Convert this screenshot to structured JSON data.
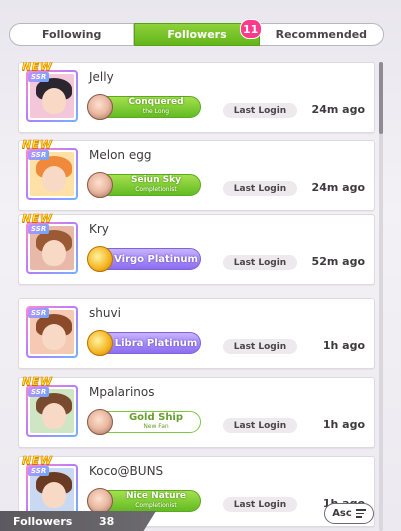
{
  "tabs": {
    "following": "Following",
    "followers": "Followers",
    "followers_badge": "11",
    "recommended": "Recommended"
  },
  "rows": [
    {
      "name": "Jelly",
      "new": "NEW",
      "rarity": "SSR",
      "title_line1": "Conquered",
      "title_line2": "the Long",
      "title_style": "green",
      "login_label": "Last Login",
      "time": "24m ago",
      "hair": "#2b2530",
      "bg": "#f4c6d9"
    },
    {
      "name": "Melon egg",
      "new": "NEW",
      "rarity": "SSR",
      "title_line1": "Seiun Sky",
      "title_line2": "Completionist",
      "title_style": "green",
      "login_label": "Last Login",
      "time": "24m ago",
      "hair": "#f08a3a",
      "bg": "#ffe1a8"
    },
    {
      "name": "Kry",
      "new": "NEW",
      "rarity": "SSR",
      "title_line1": "Virgo Platinum",
      "title_line2": "",
      "title_style": "purple",
      "login_label": "Last Login",
      "time": "52m ago",
      "hair": "#9a5a34",
      "bg": "#e8b9a8"
    },
    {
      "name": "shuvi",
      "new": "",
      "rarity": "SSR",
      "title_line1": "Libra Platinum",
      "title_line2": "",
      "title_style": "purple",
      "login_label": "Last Login",
      "time": "1h ago",
      "hair": "#8b4a2a",
      "bg": "#f5c9b4"
    },
    {
      "name": "Mpalarinos",
      "new": "NEW",
      "rarity": "SSR",
      "title_line1": "Gold Ship",
      "title_line2": "New Fan",
      "title_style": "white",
      "login_label": "Last Login",
      "time": "1h ago",
      "hair": "#7a4a2e",
      "bg": "#cfe6c4"
    },
    {
      "name": "Koco@BUNS",
      "new": "NEW",
      "rarity": "SSR",
      "title_line1": "Nice Nature",
      "title_line2": "Completionist",
      "title_style": "green",
      "login_label": "Last Login",
      "time": "1h ago",
      "hair": "#6a3a22",
      "bg": "#c9d9f2"
    }
  ],
  "footer": {
    "label": "Followers",
    "count": "38"
  },
  "sort": {
    "label": "Asc"
  }
}
